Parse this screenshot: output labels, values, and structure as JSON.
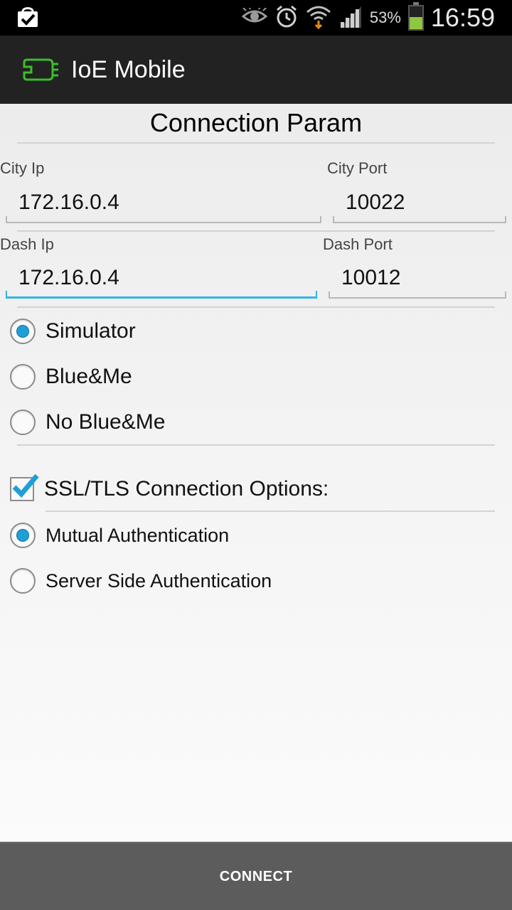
{
  "status_bar": {
    "battery_percent": "53%",
    "battery_level": 0.53,
    "time": "16:59",
    "icons": [
      "shopping-bag-check-icon",
      "eye-icon",
      "alarm-clock-icon",
      "wifi-icon",
      "signal-icon",
      "battery-icon"
    ]
  },
  "action_bar": {
    "app_title": "IoE Mobile",
    "app_icon": "ioe-logo-icon",
    "accent": "#2eb82e"
  },
  "form": {
    "section_title": "Connection Param",
    "city_ip_label": "City Ip",
    "city_ip_value": "172.16.0.4",
    "city_port_label": "City Port",
    "city_port_value": "10022",
    "dash_ip_label": "Dash Ip",
    "dash_ip_value": "172.16.0.4",
    "dash_port_label": "Dash Port",
    "dash_port_value": "10012",
    "mode_options": [
      {
        "label": "Simulator",
        "checked": true
      },
      {
        "label": "Blue&Me",
        "checked": false
      },
      {
        "label": "No Blue&Me",
        "checked": false
      }
    ],
    "ssl_label": "SSL/TLS Connection Options:",
    "ssl_checked": true,
    "auth_options": [
      {
        "label": "Mutual Authentication",
        "checked": true
      },
      {
        "label": "Server Side Authentication",
        "checked": false
      }
    ]
  },
  "connect_button": {
    "label": "CONNECT"
  },
  "colors": {
    "focus_accent": "#33b5e5",
    "radio_checked": "#1e9fd8",
    "battery_fill": "#8ec63f"
  }
}
